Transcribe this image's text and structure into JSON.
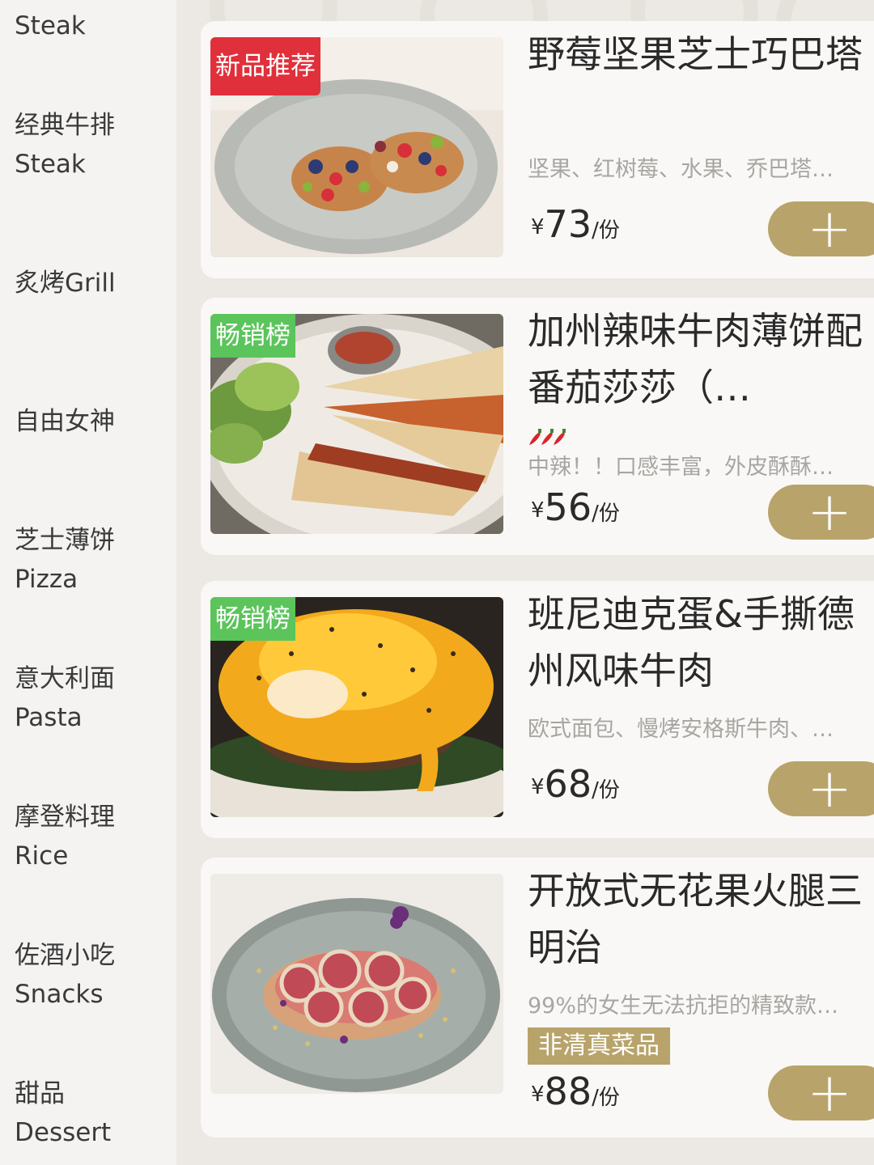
{
  "sidebar": {
    "items": [
      {
        "cn": "",
        "en": "Steak"
      },
      {
        "cn": "经典牛排",
        "en": "Steak"
      },
      {
        "cn": "炙烤Grill",
        "en": ""
      },
      {
        "cn": "自由女神",
        "en": ""
      },
      {
        "cn": "芝士薄饼",
        "en": "Pizza"
      },
      {
        "cn": "意大利面",
        "en": "Pasta"
      },
      {
        "cn": "摩登料理",
        "en": "Rice"
      },
      {
        "cn": "佐酒小吃",
        "en": "Snacks"
      },
      {
        "cn": "甜品",
        "en": "Dessert"
      }
    ]
  },
  "products": [
    {
      "badge": "新品推荐",
      "title": "野莓坚果芝士巧巴塔",
      "desc": "坚果、红树莓、水果、乔巴塔…",
      "currency": "¥",
      "price": "73",
      "unit": "/份",
      "add": "+"
    },
    {
      "badge": "畅销榜",
      "title": "加州辣味牛肉薄饼配番茄莎莎（…",
      "desc": "中辣！！口感丰富，外皮酥酥…",
      "currency": "¥",
      "price": "56",
      "unit": "/份",
      "add": "+",
      "spice_icon": "chili-pepper-icon"
    },
    {
      "badge": "畅销榜",
      "title": "班尼迪克蛋&手撕德州风味牛肉",
      "desc": "欧式面包、慢烤安格斯牛肉、…",
      "currency": "¥",
      "price": "68",
      "unit": "/份",
      "add": "+"
    },
    {
      "title": "开放式无花果火腿三明治",
      "desc": "99%的女生无法抗拒的精致款…",
      "tag": "非清真菜品",
      "currency": "¥",
      "price": "88",
      "unit": "/份",
      "add": "+"
    }
  ],
  "colors": {
    "accent": "#b8a36a",
    "badge_new": "#e0303b",
    "badge_hot": "#5bc45b"
  }
}
